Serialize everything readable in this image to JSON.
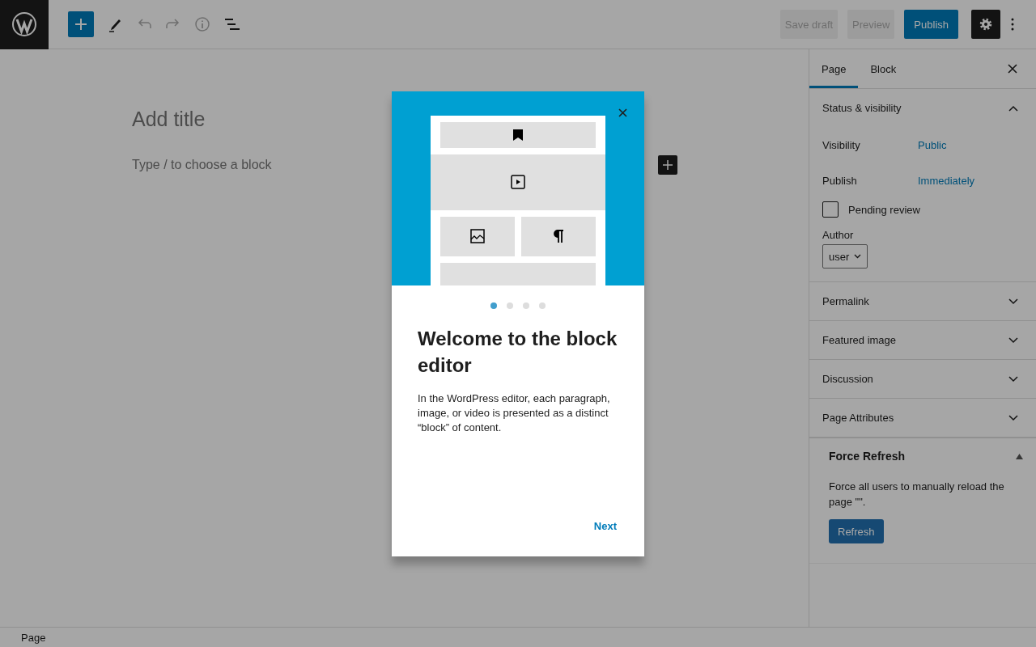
{
  "toolbar": {
    "save_draft": "Save draft",
    "preview": "Preview",
    "publish": "Publish"
  },
  "editor": {
    "title_placeholder": "Add title",
    "block_placeholder": "Type / to choose a block"
  },
  "sidebar": {
    "tabs": [
      {
        "label": "Page",
        "selected": true
      },
      {
        "label": "Block",
        "selected": false
      }
    ],
    "status_panel": {
      "title": "Status & visibility",
      "expanded": true,
      "rows": [
        {
          "label": "Visibility",
          "value": "Public"
        },
        {
          "label": "Publish",
          "value": "Immediately"
        }
      ],
      "pending_review": {
        "label": "Pending review",
        "checked": false
      },
      "author": {
        "label": "Author",
        "value": "user"
      }
    },
    "panels": [
      {
        "title": "Permalink",
        "expanded": false
      },
      {
        "title": "Featured image",
        "expanded": false
      },
      {
        "title": "Discussion",
        "expanded": false
      },
      {
        "title": "Page Attributes",
        "expanded": false
      }
    ],
    "force_refresh": {
      "title": "Force Refresh",
      "expanded": true,
      "text": "Force all users to manually reload the page \"\".",
      "button": "Refresh"
    }
  },
  "modal": {
    "pages": [
      {
        "selected": true
      },
      {
        "selected": false
      },
      {
        "selected": false
      },
      {
        "selected": false
      }
    ],
    "title": "Welcome to the block editor",
    "body": "In the WordPress editor, each paragraph, image, or video is presented as a distinct “block” of content.",
    "next": "Next"
  },
  "status_bar": {
    "label": "Page"
  }
}
